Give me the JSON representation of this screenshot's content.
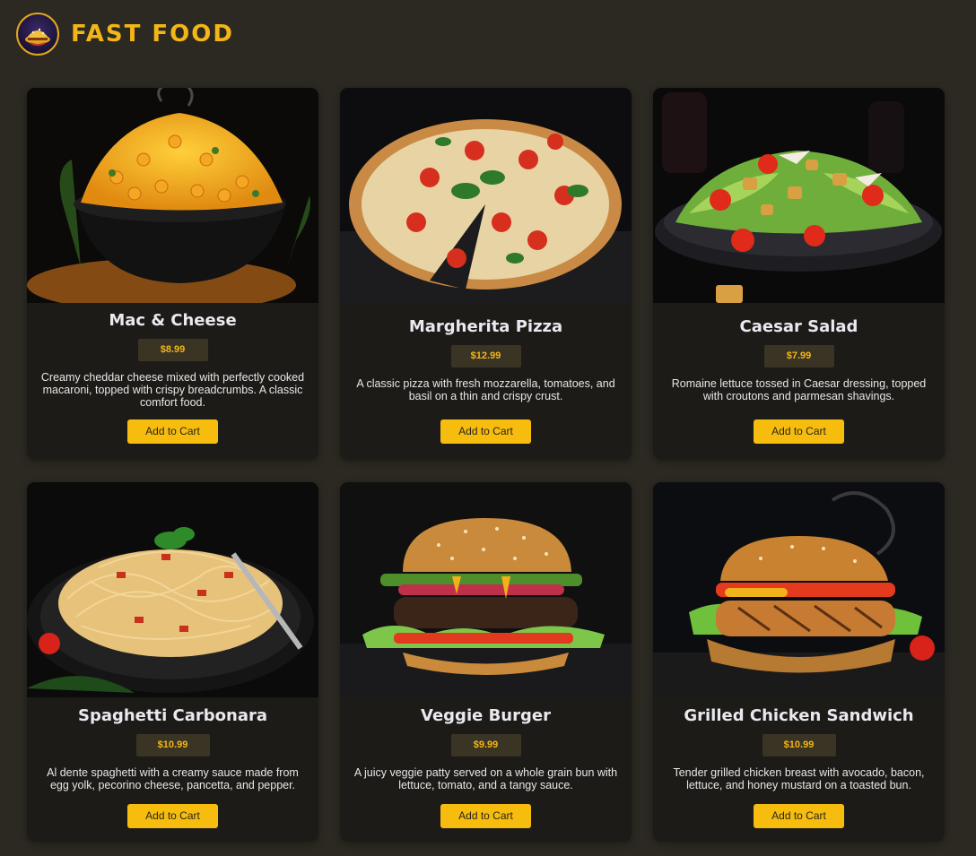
{
  "header": {
    "brand": "FAST FOOD",
    "logo_icon": "food-logo-icon"
  },
  "accent_color": "#f3b617",
  "menu": [
    {
      "title": "Mac & Cheese",
      "price": "$8.99",
      "description": "Creamy cheddar cheese mixed with perfectly cooked macaroni, topped with crispy breadcrumbs. A classic comfort food.",
      "button": "Add to Cart",
      "image": "mac-and-cheese-image"
    },
    {
      "title": "Margherita Pizza",
      "price": "$12.99",
      "description": "A classic pizza with fresh mozzarella, tomatoes, and basil on a thin and crispy crust.",
      "button": "Add to Cart",
      "image": "margherita-pizza-image"
    },
    {
      "title": "Caesar Salad",
      "price": "$7.99",
      "description": "Romaine lettuce tossed in Caesar dressing, topped with croutons and parmesan shavings.",
      "button": "Add to Cart",
      "image": "caesar-salad-image"
    },
    {
      "title": "Spaghetti Carbonara",
      "price": "$10.99",
      "description": "Al dente spaghetti with a creamy sauce made from egg yolk, pecorino cheese, pancetta, and pepper.",
      "button": "Add to Cart",
      "image": "spaghetti-carbonara-image"
    },
    {
      "title": "Veggie Burger",
      "price": "$9.99",
      "description": "A juicy veggie patty served on a whole grain bun with lettuce, tomato, and a tangy sauce.",
      "button": "Add to Cart",
      "image": "veggie-burger-image"
    },
    {
      "title": "Grilled Chicken Sandwich",
      "price": "$10.99",
      "description": "Tender grilled chicken breast with avocado, bacon, lettuce, and honey mustard on a toasted bun.",
      "button": "Add to Cart",
      "image": "grilled-chicken-sandwich-image"
    }
  ]
}
